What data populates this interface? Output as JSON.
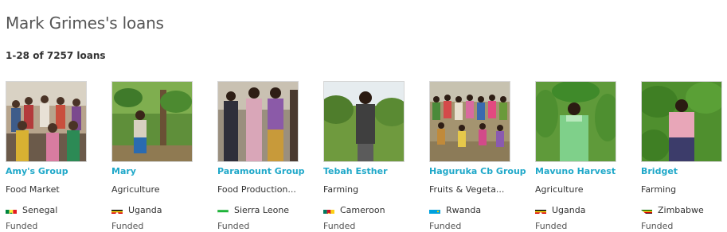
{
  "page": {
    "title": "Mark Grimes's loans",
    "count_text": "1-28 of 7257 loans"
  },
  "loans": [
    {
      "name": "Amy's Group",
      "sector": "Food Market",
      "country": "Senegal",
      "flag": "flag-senegal",
      "status": "Funded",
      "photo": "group-of-women-photo"
    },
    {
      "name": "Mary",
      "sector": "Agriculture",
      "country": "Uganda",
      "flag": "flag-uganda",
      "status": "Funded",
      "photo": "woman-in-cocoa-farm-photo"
    },
    {
      "name": "Paramount Group",
      "sector": "Food Production...",
      "country": "Sierra Leone",
      "flag": "flag-sierra-leone",
      "status": "Funded",
      "photo": "three-women-photo"
    },
    {
      "name": "Tebah Esther",
      "sector": "Farming",
      "country": "Cameroon",
      "flag": "flag-cameroon",
      "status": "Funded",
      "photo": "woman-in-field-photo"
    },
    {
      "name": "Haguruka Cb Group",
      "sector": "Fruits & Vegeta...",
      "country": "Rwanda",
      "flag": "flag-rwanda",
      "status": "Funded",
      "photo": "large-group-photo"
    },
    {
      "name": "Mavuno Harvest",
      "sector": "Agriculture",
      "country": "Uganda",
      "flag": "flag-uganda",
      "status": "Funded",
      "photo": "woman-carrying-leaves-photo"
    },
    {
      "name": "Bridget",
      "sector": "Farming",
      "country": "Zimbabwe",
      "flag": "flag-zimbabwe",
      "status": "Funded",
      "photo": "woman-in-crop-field-photo"
    }
  ]
}
